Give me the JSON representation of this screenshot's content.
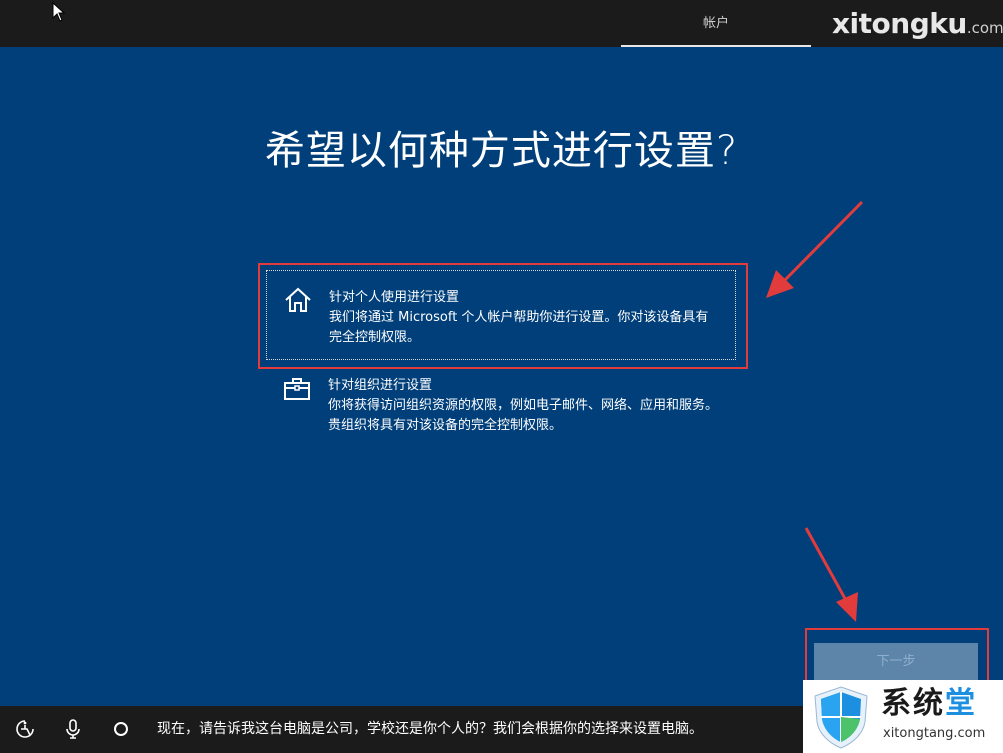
{
  "header": {
    "tab_label": "帐户",
    "watermark_main": "xitongku",
    "watermark_suffix": ".com"
  },
  "main": {
    "heading": "希望以何种方式进行设置?",
    "options": [
      {
        "icon": "home-icon",
        "title": "针对个人使用进行设置",
        "description": "我们将通过 Microsoft 个人帐户帮助你进行设置。你对该设备具有完全控制权限。",
        "selected": true
      },
      {
        "icon": "briefcase-icon",
        "title": "针对组织进行设置",
        "description": "你将获得访问组织资源的权限，例如电子邮件、网络、应用和服务。贵组织将具有对该设备的完全控制权限。",
        "selected": false
      }
    ],
    "next_button": "下一步"
  },
  "footer": {
    "icons": [
      "accessibility-icon",
      "microphone-icon",
      "cortana-icon"
    ],
    "prompt": "现在，请告诉我这台电脑是公司，学校还是你个人的？我们会根据你的选择来设置电脑。"
  },
  "watermark_bottom": {
    "brand_part1": "系统",
    "brand_part2": "堂",
    "url": "xitongtang.com"
  },
  "colors": {
    "background": "#003f7a",
    "bars": "#1b1b1b",
    "annotation": "#e23b3b",
    "next_button_bg": "#5d84a9",
    "watermark_accent": "#1d8fe0"
  }
}
